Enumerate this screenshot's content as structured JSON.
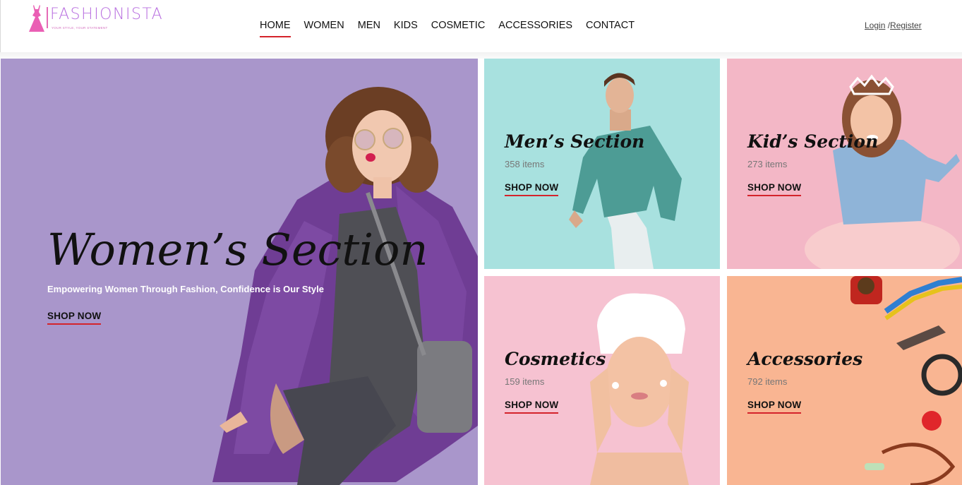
{
  "brand": {
    "name": "FASHIONISTA",
    "tagline": "YOUR STYLE, YOUR STATEMENT",
    "logo_icon": "dress-icon"
  },
  "nav": {
    "items": [
      "HOME",
      "WOMEN",
      "MEN",
      "KIDS",
      "COSMETIC",
      "ACCESSORIES",
      "CONTACT"
    ],
    "active": "HOME"
  },
  "auth": {
    "login": "Login",
    "separator": " /",
    "register": "Register"
  },
  "hero": {
    "title": "Women’s Section",
    "subtitle": "Empowering Women Through Fashion, Confidence is Our Style",
    "cta": "SHOP NOW",
    "bg_color": "#a996cb"
  },
  "sections": [
    {
      "title": "Men’s Section",
      "count": "358 items",
      "cta": "SHOP NOW",
      "bg_color": "#a8e1df"
    },
    {
      "title": "Kid’s Section",
      "count": "273 items",
      "cta": "SHOP NOW",
      "bg_color": "#f3b7c6"
    },
    {
      "title": "Cosmetics",
      "count": "159 items",
      "cta": "SHOP NOW",
      "bg_color": "#f6c2d1"
    },
    {
      "title": "Accessories",
      "count": "792 items",
      "cta": "SHOP NOW",
      "bg_color": "#f9b592"
    }
  ],
  "colors": {
    "accent": "#d4232b",
    "brand": "#b970e0"
  }
}
